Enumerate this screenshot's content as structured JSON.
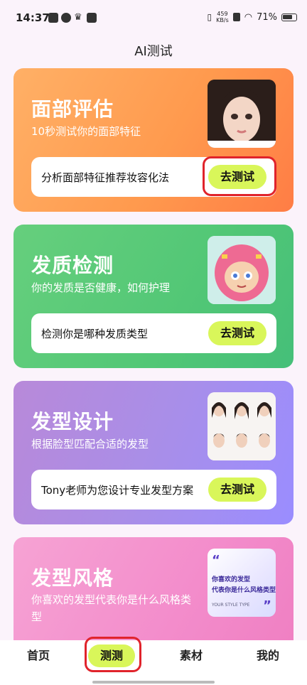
{
  "status": {
    "time": "14:37",
    "net_speed": "459",
    "net_unit": "KB/s",
    "battery": "71%"
  },
  "page_title": "AI测试",
  "cards": [
    {
      "title": "面部评估",
      "subtitle": "10秒测试你的面部特征",
      "desc": "分析面部特征推荐妆容化法",
      "button": "去测试"
    },
    {
      "title": "发质检测",
      "subtitle": "你的发质是否健康，如何护理",
      "desc": "检测你是哪种发质类型",
      "button": "去测试"
    },
    {
      "title": "发型设计",
      "subtitle": "根据脸型匹配合适的发型",
      "desc": "Tony老师为您设计专业发型方案",
      "button": "去测试"
    },
    {
      "title": "发型风格",
      "subtitle": "你喜欢的发型代表你是什么风格类型",
      "thumb_line1": "你喜欢的发型",
      "thumb_line2": "代表你是什么风格类型?",
      "thumb_tag": "YOUR STYLE TYPE"
    }
  ],
  "nav": {
    "home": "首页",
    "test": "测测",
    "material": "素材",
    "mine": "我的"
  },
  "colors": {
    "accent": "#d9f65a",
    "highlight": "#e0232b"
  }
}
